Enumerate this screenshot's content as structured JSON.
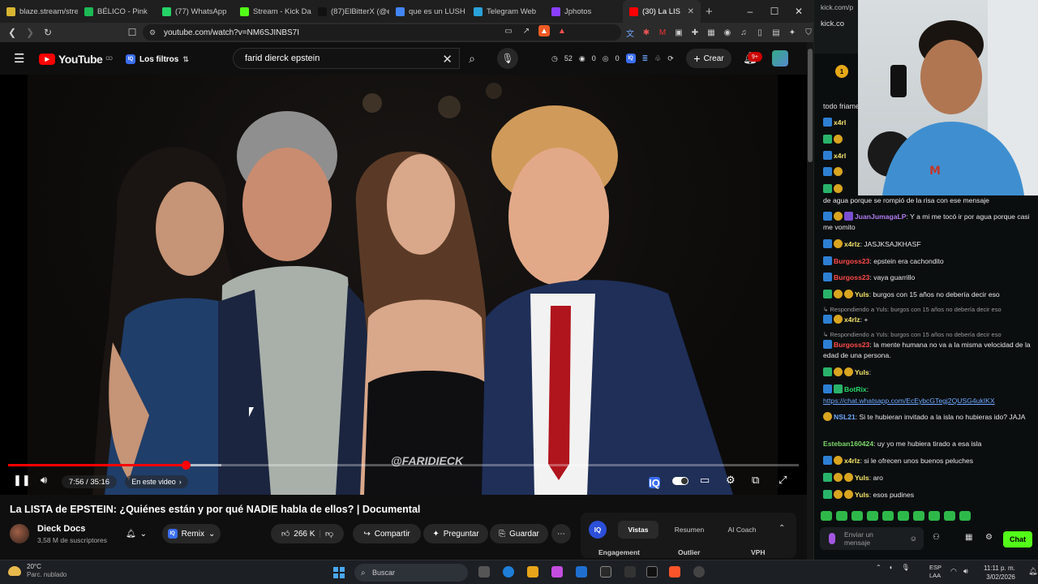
{
  "browser": {
    "tabs": [
      {
        "label": "blaze.stream/stre",
        "color": "#d7b531"
      },
      {
        "label": "BÉLICO - Pink",
        "color": "#1db954"
      },
      {
        "label": "(77) WhatsApp",
        "color": "#25d366"
      },
      {
        "label": "Stream - Kick Da",
        "color": "#53fc18"
      },
      {
        "label": "(87)ElBitterX (@e",
        "color": "#111111"
      },
      {
        "label": "que es un LUSH",
        "color": "#4285f4"
      },
      {
        "label": "Telegram Web",
        "color": "#2aa1da"
      },
      {
        "label": "Jphotos",
        "color": "#8a3ffc"
      },
      {
        "label": "(30) La LIS",
        "color": "#ff0000"
      }
    ],
    "url": "youtube.com/watch?v=NM6SJINBS7I",
    "chat_url": "kick.com/p",
    "chat_url_sub": "kick.co"
  },
  "youtube": {
    "logo_text": "YouTube",
    "logo_country": "CO",
    "filters_label": "Los filtros",
    "search_value": "farid dierck epstein",
    "header_stats": [
      "52",
      "0",
      "0"
    ],
    "create_label": "Crear",
    "bell_badge": "9+",
    "video": {
      "watermark": "@FARIDIECK",
      "timecode": "7:56 / 35:16",
      "chapter_label": "En este video",
      "progress": 0.225,
      "buffer": 0.27
    },
    "title": "La LISTA de EPSTEIN: ¿Quiénes están y por qué NADIE habla de ellos? | Documental",
    "channel_name": "Dieck Docs",
    "subscribers": "3,58 M de suscriptores",
    "remix_label": "Remix",
    "likes": "266 K",
    "share_label": "Compartir",
    "ask_label": "Preguntar",
    "save_label": "Guardar",
    "iq_panel": {
      "logo": "IQ",
      "tabs": [
        "Vistas",
        "Resumen",
        "AI Coach"
      ],
      "columns": [
        "Engagement",
        "Outlier",
        "VPH"
      ]
    }
  },
  "chat": {
    "pinned_text": "todo friame",
    "messages": [
      {
        "user": "x4rl",
        "color": "#f5e56b",
        "text": "",
        "badges": [
          "b-blue"
        ]
      },
      {
        "user": "",
        "color": "#f5e56b",
        "text": "",
        "badges": [
          "b-green",
          "b-gold"
        ]
      },
      {
        "user": "x4rl",
        "color": "#f5e56b",
        "text": "",
        "badges": [
          "b-blue"
        ]
      },
      {
        "user": "",
        "color": "#f5e56b",
        "text": "",
        "badges": [
          "b-blue",
          "b-gold"
        ]
      },
      {
        "user": "",
        "color": "#f5e56b",
        "text": "",
        "badges": [
          "b-green",
          "b-gold"
        ]
      },
      {
        "user": "",
        "color": "#e8e8e8",
        "text": "de agua porque se rompió de la risa con ese mensaje",
        "badges": []
      },
      {
        "user": "JuanJumagaLP",
        "color": "#b07cf0",
        "text": ": Y a mi me tocó ir por agua porque casi me vomito",
        "badges": [
          "b-blue",
          "b-gold",
          "b-purple"
        ]
      },
      {
        "user": "x4rlz",
        "color": "#f5e56b",
        "text": ": JASJKSAJKHASF",
        "badges": [
          "b-blue",
          "b-gold"
        ]
      },
      {
        "user": "Burgoss23",
        "color": "#ff4a4a",
        "text": ": epstein era cachondito",
        "badges": [
          "b-blue"
        ]
      },
      {
        "user": "Burgoss23",
        "color": "#ff4a4a",
        "text": ": vaya guarrillo",
        "badges": [
          "b-blue"
        ]
      },
      {
        "user": "Yuls",
        "color": "#f5e56b",
        "text": ": burgos con 15 años no debería decir eso",
        "badges": [
          "b-green",
          "b-gold",
          "b-gold"
        ]
      },
      {
        "user": "x4rlz",
        "color": "#f5e56b",
        "text": ": +",
        "badges": [
          "b-blue",
          "b-gold"
        ]
      },
      {
        "user": "Burgoss23",
        "color": "#ff4a4a",
        "text": ": la mente humana no va a la misma velocidad de la edad de una persona.",
        "badges": [
          "b-blue"
        ]
      },
      {
        "user": "Yuls",
        "color": "#f5e56b",
        "text": ":",
        "badges": [
          "b-green",
          "b-gold",
          "b-gold"
        ]
      },
      {
        "user": "BotRix",
        "color": "#29d96a",
        "text": ":",
        "badges": [
          "b-blue",
          "b-green"
        ]
      },
      {
        "user": "",
        "color": "#6fa8ff",
        "text": "https://chat.whatsapp.com/EcEybcGTegj2QUSG4ukIKX",
        "badges": []
      },
      {
        "user": "NSL21",
        "color": "#6fa8ff",
        "text": ": Si te hubieran invitado a la isla no hubieras ido? JAJA",
        "badges": [
          "b-gold"
        ]
      },
      {
        "user": "Esteban160424",
        "color": "#7cd86a",
        "text": ": uy yo me hubiera tirado a esa isla",
        "badges": []
      },
      {
        "user": "x4rlz",
        "color": "#f5e56b",
        "text": ": si le ofrecen unos buenos peluches",
        "badges": [
          "b-blue",
          "b-gold"
        ]
      },
      {
        "user": "Yuls",
        "color": "#f5e56b",
        "text": ": aro",
        "badges": [
          "b-green",
          "b-gold",
          "b-gold"
        ]
      },
      {
        "user": "Yuls",
        "color": "#f5e56b",
        "text": ": esos pudines",
        "badges": [
          "b-green",
          "b-gold",
          "b-gold"
        ]
      }
    ],
    "reply_1": "Respondiendo a Yuls: burgos con 15 años no debería decir eso",
    "reply_2": "Respondiendo a Yuls: burgos con 15 años no debería decir eso",
    "input_placeholder": "Enviar un mensaje",
    "send_label": "Chat"
  },
  "taskbar": {
    "temperature": "20°C",
    "weather": "Parc. nublado",
    "search_placeholder": "Buscar",
    "lang_1": "ESP",
    "lang_2": "LAA",
    "time": "11:11 p. m.",
    "date": "3/02/2026"
  }
}
